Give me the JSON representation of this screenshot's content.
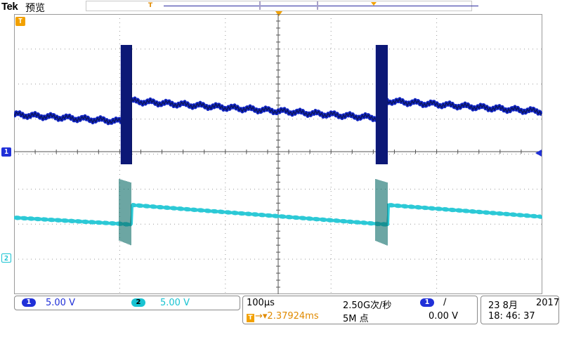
{
  "header": {
    "brand": "Tek",
    "mode": "预览",
    "record_trigger_marker": "T"
  },
  "display": {
    "trigger_marker": "T",
    "ch1_marker": "1",
    "ch2_marker": "2",
    "colors": {
      "grid": "#9a9a9a",
      "ch1": "#1428c8",
      "ch1_dark": "#0a1560",
      "ch2": "#2cc9d6",
      "ch2_dark": "#0a6a66",
      "trigger": "#f2a100"
    }
  },
  "status": {
    "ch1": {
      "label": "1",
      "scale": "5.00 V"
    },
    "ch2": {
      "label": "2",
      "scale": "5.00 V"
    },
    "timebase": "100µs",
    "sample_rate": "2.50G次/秒",
    "trigger_position": "2.37924ms",
    "record_length": "5M 点",
    "trigger": {
      "source": "1",
      "slope": "∕",
      "level": "0.00 V"
    },
    "date": "23 8月",
    "year": "2017",
    "time": "18: 46: 37"
  }
}
